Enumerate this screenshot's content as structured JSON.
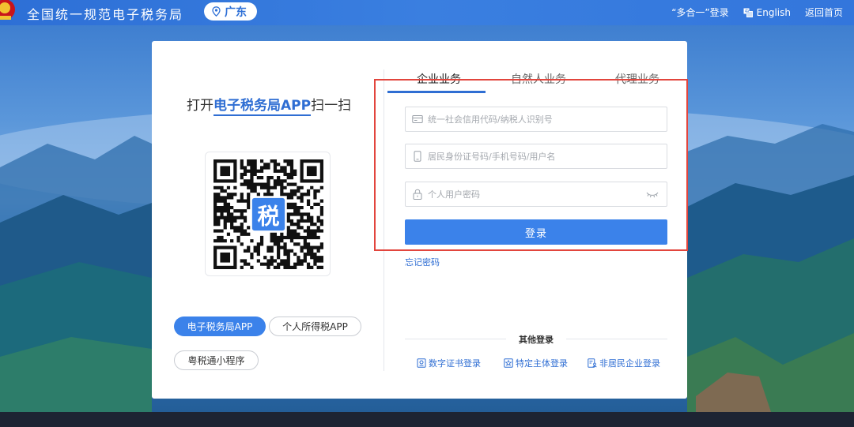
{
  "header": {
    "site_title": "全国统一规范电子税务局",
    "region": "广东",
    "links": {
      "multi_login": "“多合一”登录",
      "english": "English",
      "home": "返回首页"
    }
  },
  "scan": {
    "prefix": "打开",
    "app_name": "电子税务局APP",
    "suffix": "扫一扫",
    "qr_center": "税",
    "app_buttons": [
      "电子税务局APP",
      "个人所得税APP",
      "粤税通小程序"
    ]
  },
  "tabs": [
    "企业业务",
    "自然人业务",
    "代理业务"
  ],
  "form": {
    "credit_code_placeholder": "统一社会信用代码/纳税人识别号",
    "account_placeholder": "居民身份证号码/手机号码/用户名",
    "password_placeholder": "个人用户密码",
    "login_label": "登录",
    "forgot_label": "忘记密码"
  },
  "other_login": {
    "title": "其他登录",
    "options": [
      "数字证书登录",
      "特定主体登录",
      "非居民企业登录"
    ]
  },
  "colors": {
    "brand": "#3b82ea",
    "link": "#2f6ed3",
    "highlight": "#e2453d"
  }
}
